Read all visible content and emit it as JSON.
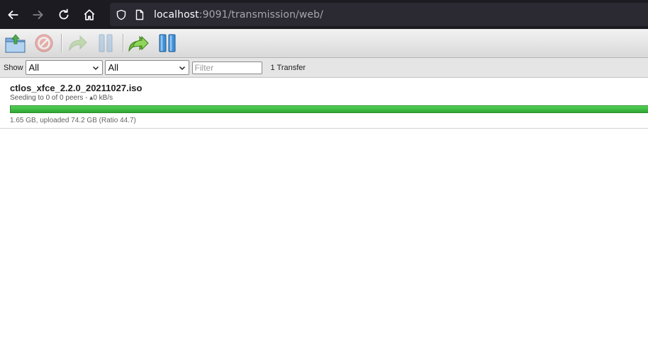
{
  "browser": {
    "url_host": "localhost",
    "url_rest": ":9091/transmission/web/",
    "icons": [
      "back-arrow-icon",
      "forward-arrow-icon",
      "reload-icon",
      "home-icon",
      "shield-icon",
      "page-icon"
    ]
  },
  "toolbar": {
    "buttons": [
      "open-torrent",
      "remove-torrent",
      "resume-torrent",
      "pause-torrent",
      "resume-all",
      "pause-all"
    ]
  },
  "filterbar": {
    "show_label": "Show",
    "state_filter": "All",
    "tracker_filter": "All",
    "filter_placeholder": "Filter",
    "transfer_count": "1 Transfer"
  },
  "torrents": [
    {
      "name": "ctlos_xfce_2.2.0_20211027.iso",
      "peers": "Seeding to 0 of 0 peers - ▴0 kB/s",
      "progress_text": "1.65 GB, uploaded 74.2 GB (Ratio 44.7)",
      "progress_percent": 100,
      "status_color": "#3cb53f"
    }
  ]
}
